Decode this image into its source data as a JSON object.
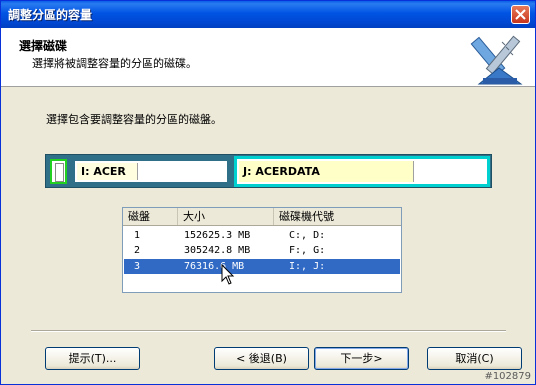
{
  "window": {
    "title": "調整分區的容量"
  },
  "header": {
    "title": "選擇磁碟",
    "subtitle": "選擇將被調整容量的分區的磁碟。",
    "icon": "resize-tool-icon"
  },
  "instruction": "選擇包含要調整容量的分區的磁盤。",
  "disk_map": {
    "partitions": [
      {
        "label": "",
        "color": "#ffffff"
      },
      {
        "label": "I:  ACER",
        "color": "#ffffe0"
      },
      {
        "label": "J:  ACERDATA",
        "color": "#ffffc8"
      }
    ],
    "selected_border": "#00d0d0",
    "small_border": "#22d022"
  },
  "disk_list": {
    "columns": [
      "磁盤",
      "大小",
      "磁碟機代號"
    ],
    "rows": [
      {
        "disk": "1",
        "size": "152625.3 MB",
        "drives": "C:, D:"
      },
      {
        "disk": "2",
        "size": "305242.8 MB",
        "drives": "F:, G:"
      },
      {
        "disk": "3",
        "size": "76316.6 MB",
        "drives": "I:, J:"
      }
    ],
    "selected_index": 2,
    "selected_color": "#316ac5"
  },
  "buttons": {
    "hint": "提示(T)...",
    "back": "< 後退(B)",
    "next": "下一步>",
    "cancel": "取消(C)"
  },
  "watermark": "#102879"
}
